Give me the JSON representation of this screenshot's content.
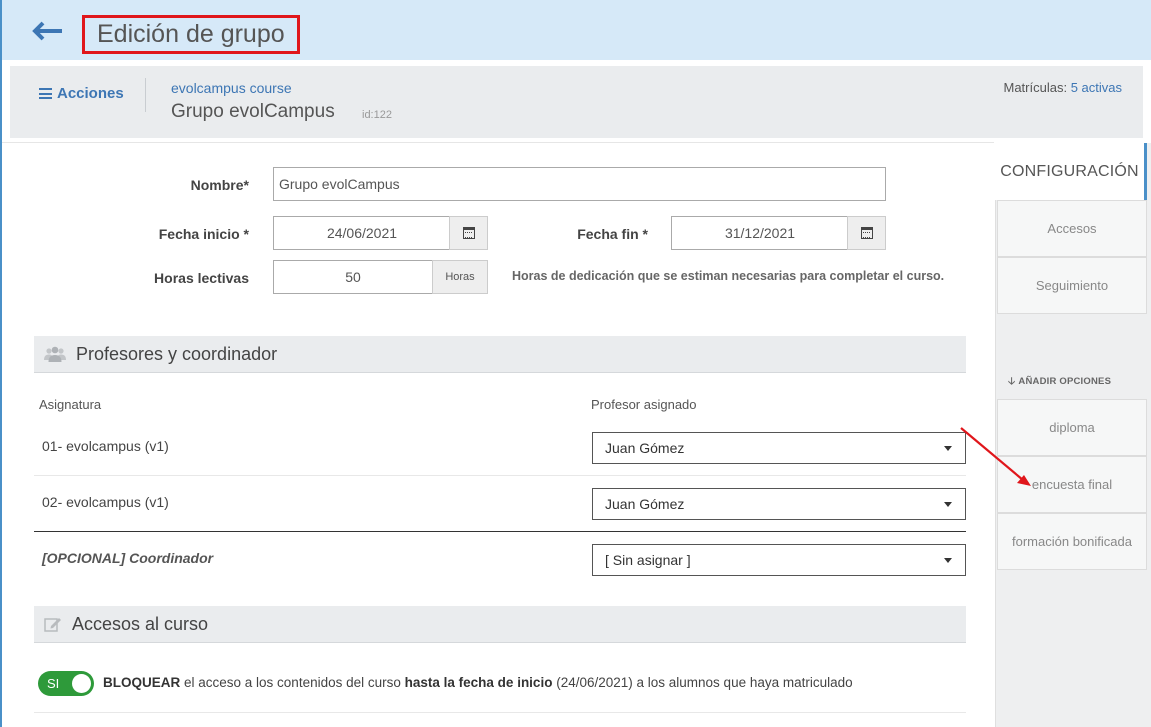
{
  "header": {
    "title": "Edición de grupo"
  },
  "subheader": {
    "actions_label": "Acciones",
    "course_link": "evolcampus course",
    "group_name": "Grupo evolCampus",
    "group_id": "id:122",
    "enrollments_label": "Matrículas:",
    "enrollments_value": "5 activas"
  },
  "form": {
    "name_label": "Nombre*",
    "name_value": "Grupo evolCampus",
    "start_label": "Fecha inicio *",
    "start_value": "24/06/2021",
    "end_label": "Fecha fin *",
    "end_value": "31/12/2021",
    "hours_label": "Horas lectivas",
    "hours_value": "50",
    "hours_unit": "Horas",
    "hours_help": "Horas de dedicación que se estiman necesarias para completar el curso."
  },
  "teachers": {
    "title": "Profesores y coordinador",
    "col_subject": "Asignatura",
    "col_teacher": "Profesor asignado",
    "rows": [
      {
        "subject": "01- evolcampus (v1)",
        "teacher": "Juan Gómez"
      },
      {
        "subject": "02- evolcampus (v1)",
        "teacher": "Juan Gómez"
      }
    ],
    "coordinator_label": "[OPCIONAL] Coordinador",
    "coordinator_value": "[ Sin asignar ]"
  },
  "access": {
    "title": "Accesos al curso",
    "toggle_label": "SI",
    "text_bold_1": "BLOQUEAR",
    "text_1": " el acceso a los contenidos del curso ",
    "text_bold_2": "hasta la fecha de inicio",
    "text_2": " (24/06/2021) a los alumnos que haya matriculado"
  },
  "sidebar": {
    "active_tab": "CONFIGURACIÓN",
    "tabs": [
      "Accesos",
      "Seguimiento"
    ],
    "add_options_label": "AÑADIR OPCIONES",
    "options": [
      "diploma",
      "encuesta final",
      "formación bonificada"
    ]
  },
  "colors": {
    "header_bg": "#d6e9f8",
    "accent": "#3d76b4",
    "highlight_box": "#e0161b",
    "toggle_on": "#2e9a3a",
    "annotation_arrow": "#e0161b"
  }
}
